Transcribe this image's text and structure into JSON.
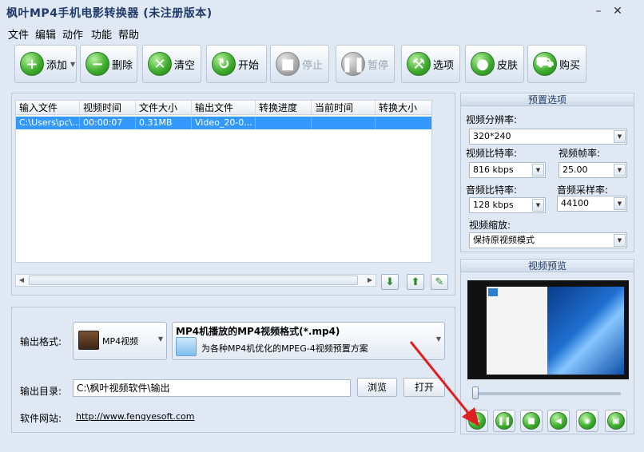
{
  "window": {
    "title": "枫叶MP4手机电影转换器  (未注册版本)"
  },
  "menu": [
    "文件",
    "编辑",
    "动作",
    "功能",
    "帮助"
  ],
  "toolbar": {
    "add": "添加",
    "delete": "删除",
    "clear": "清空",
    "start": "开始",
    "stop": "停止",
    "pause": "暂停",
    "options": "选项",
    "skin": "皮肤",
    "buy": "购买"
  },
  "table": {
    "columns": [
      "输入文件",
      "视频时间",
      "文件大小",
      "输出文件",
      "转换进度",
      "当前时间",
      "转换大小"
    ],
    "rows": [
      [
        "C:\\Users\\pc\\...",
        "00:00:07",
        "0.31MB",
        "Video_20-0...",
        "",
        "",
        ""
      ]
    ]
  },
  "output": {
    "format_label": "输出格式:",
    "format_category": "MP4视频",
    "format_name": "MP4机播放的MP4视频格式(*.mp4)",
    "format_desc": "为各种MP4机优化的MPEG-4视频预置方案",
    "dir_label": "输出目录:",
    "dir_value": "C:\\枫叶视频软件\\输出",
    "browse": "浏览",
    "open": "打开",
    "site_label": "软件网站:",
    "site_url": "http://www.fengyesoft.com"
  },
  "preset": {
    "title": "预置选项",
    "resolution_label": "视频分辨率:",
    "resolution": "320*240",
    "vbitrate_label": "视频比特率:",
    "vbitrate": "816 kbps",
    "fps_label": "视频帧率:",
    "fps": "25.00",
    "abitrate_label": "音频比特率:",
    "abitrate": "128 kbps",
    "samplerate_label": "音频采样率:",
    "samplerate": "44100",
    "scale_label": "视频缩放:",
    "scale": "保持原视频模式"
  },
  "preview": {
    "title": "视频预览"
  },
  "colors": {
    "accent": "#3399ff",
    "green": "#3fae2d",
    "arrow": "#e02020"
  }
}
